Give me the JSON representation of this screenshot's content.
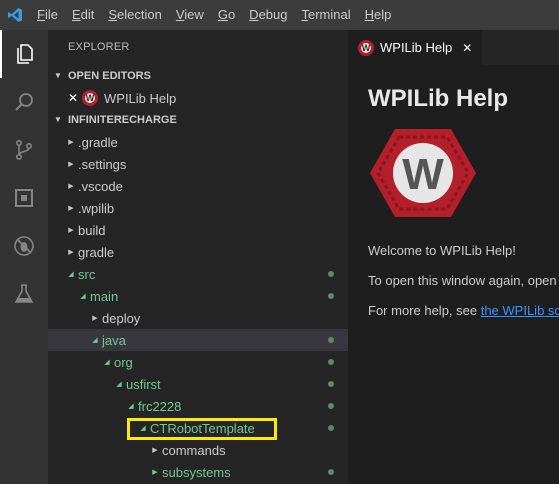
{
  "menubar": {
    "items": [
      {
        "first": "F",
        "rest": "ile"
      },
      {
        "first": "E",
        "rest": "dit"
      },
      {
        "first": "S",
        "rest": "election"
      },
      {
        "first": "V",
        "rest": "iew"
      },
      {
        "first": "G",
        "rest": "o"
      },
      {
        "first": "D",
        "rest": "ebug"
      },
      {
        "first": "T",
        "rest": "erminal"
      },
      {
        "first": "H",
        "rest": "elp"
      }
    ]
  },
  "activitybar": {
    "icons": [
      "explorer-icon",
      "search-icon",
      "source-control-icon",
      "extensions-icon",
      "debug-icon",
      "test-flask-icon"
    ]
  },
  "sidebar": {
    "title": "EXPLORER",
    "open_editors_header": "OPEN EDITORS",
    "open_editors": [
      {
        "label": "WPILib Help"
      }
    ],
    "project_header": "INFINITERECHARGE",
    "tree": [
      {
        "label": ".gradle",
        "depth": 0,
        "expanded": false
      },
      {
        "label": ".settings",
        "depth": 0,
        "expanded": false
      },
      {
        "label": ".vscode",
        "depth": 0,
        "expanded": false
      },
      {
        "label": ".wpilib",
        "depth": 0,
        "expanded": false
      },
      {
        "label": "build",
        "depth": 0,
        "expanded": false
      },
      {
        "label": "gradle",
        "depth": 0,
        "expanded": false
      },
      {
        "label": "src",
        "depth": 0,
        "expanded": true,
        "git": true
      },
      {
        "label": "main",
        "depth": 1,
        "expanded": true,
        "git": true
      },
      {
        "label": "deploy",
        "depth": 2,
        "expanded": false
      },
      {
        "label": "java",
        "depth": 2,
        "expanded": true,
        "git": true,
        "selected": true
      },
      {
        "label": "org",
        "depth": 3,
        "expanded": true,
        "git": true
      },
      {
        "label": "usfirst",
        "depth": 4,
        "expanded": true,
        "git": true
      },
      {
        "label": "frc2228",
        "depth": 5,
        "expanded": true,
        "git": true
      },
      {
        "label": "CTRobotTemplate",
        "depth": 6,
        "expanded": true,
        "git": true
      },
      {
        "label": "commands",
        "depth": 7,
        "expanded": false
      },
      {
        "label": "subsystems",
        "depth": 7,
        "expanded": false,
        "git": true
      }
    ]
  },
  "editor": {
    "tab_label": "WPILib Help",
    "heading": "WPILib Help",
    "logo_letter": "W",
    "welcome": "Welcome to WPILib Help!",
    "reopen_text": "To open this window again, open",
    "more_help_text": "For more help, see ",
    "more_help_link": "the WPILib scr"
  },
  "colors": {
    "accent_logo": "#b31f2a",
    "git_green": "#73c991",
    "highlight": "#ffea00",
    "link": "#3794ff"
  }
}
